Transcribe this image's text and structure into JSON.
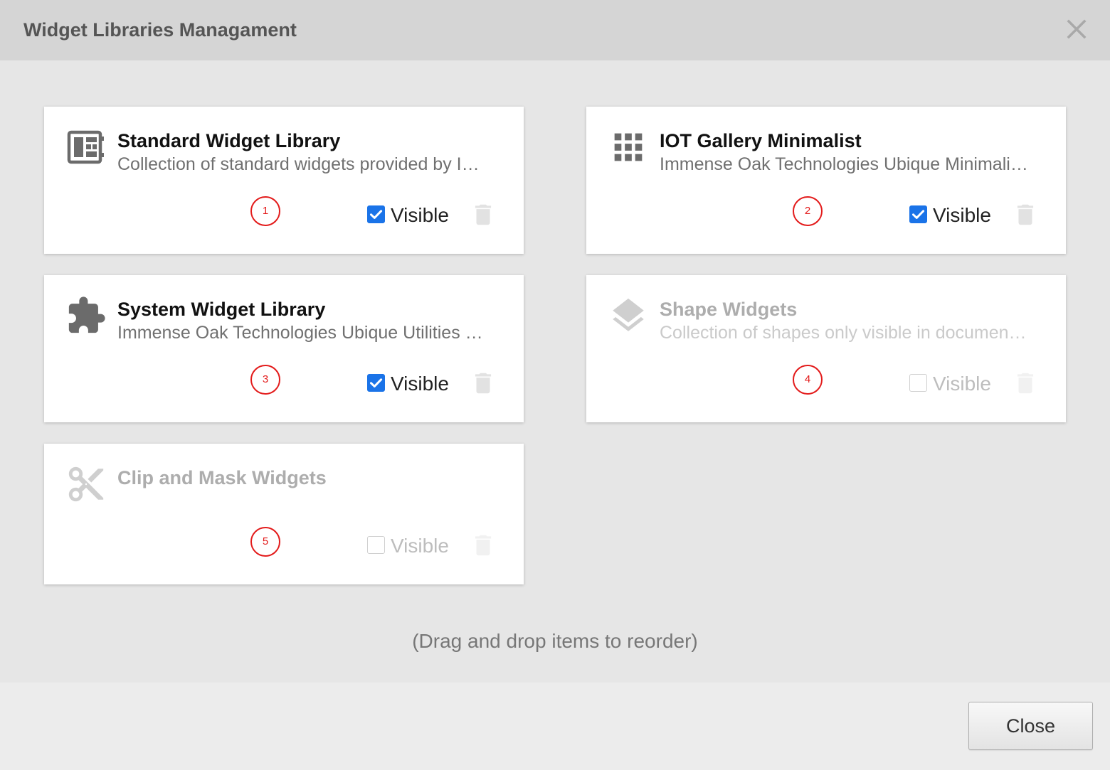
{
  "dialog": {
    "title": "Widget Libraries Managament",
    "close_icon": "close-icon",
    "hint": "(Drag and drop items to reorder)",
    "close_button_label": "Close"
  },
  "libraries": [
    {
      "order": "1",
      "name": "Standard Widget Library",
      "description": "Collection of standard widgets provided by I…",
      "visible_label": "Visible",
      "visible": true,
      "icon": "widget-library-icon"
    },
    {
      "order": "2",
      "name": "IOT Gallery Minimalist",
      "description": "Immense Oak Technologies Ubique Minimali…",
      "visible_label": "Visible",
      "visible": true,
      "icon": "apps-grid-icon"
    },
    {
      "order": "3",
      "name": "System Widget Library",
      "description": "Immense Oak Technologies Ubique Utilities …",
      "visible_label": "Visible",
      "visible": true,
      "icon": "puzzle-icon"
    },
    {
      "order": "4",
      "name": "Shape Widgets",
      "description": "Collection of shapes only visible in documen…",
      "visible_label": "Visible",
      "visible": false,
      "icon": "layers-icon"
    },
    {
      "order": "5",
      "name": "Clip and Mask Widgets",
      "visible_label": "Visible",
      "visible": false,
      "icon": "scissors-icon"
    }
  ],
  "item_icons": {
    "delete": "trash-icon",
    "visibility_checkbox": "checkbox"
  },
  "colors": {
    "accent": "#1a73e8",
    "annotation": "#e31b1b",
    "header_bg": "#d5d5d5",
    "body_bg": "#e6e6e6",
    "footer_bg": "#ececec"
  }
}
